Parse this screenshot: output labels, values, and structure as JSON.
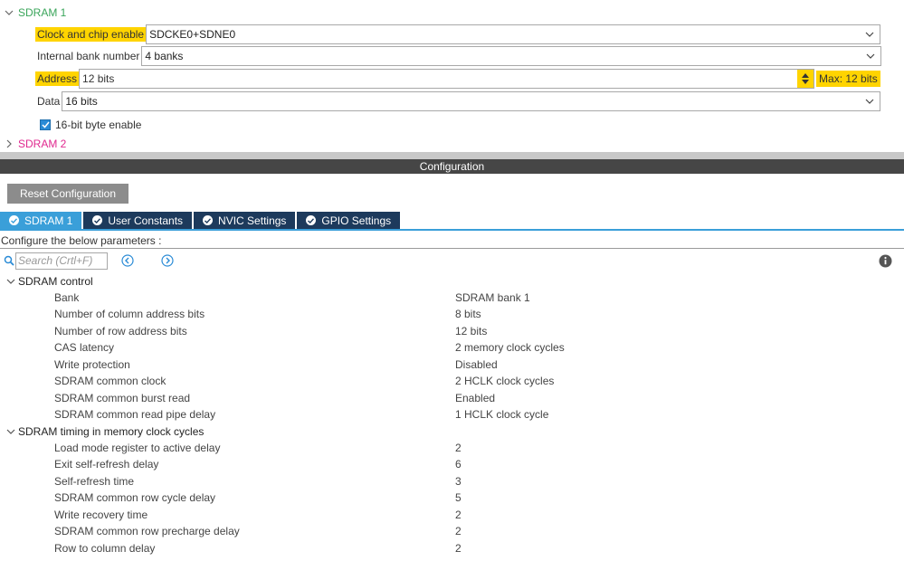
{
  "top_tree": {
    "sdram1": {
      "label": "SDRAM 1"
    },
    "sdram2": {
      "label": "SDRAM 2"
    },
    "clock_chip": {
      "label": "Clock and chip enable",
      "value": "SDCKE0+SDNE0"
    },
    "bank_number": {
      "label": "Internal bank number",
      "value": "4 banks"
    },
    "address": {
      "label": "Address",
      "value": "12 bits",
      "max": "Max: 12 bits"
    },
    "data": {
      "label": "Data",
      "value": "16 bits"
    },
    "byte_enable": {
      "label": "16-bit byte enable",
      "checked": true
    }
  },
  "config_header": "Configuration",
  "reset_button": "Reset Configuration",
  "tabs": [
    {
      "label": "SDRAM 1",
      "active": true
    },
    {
      "label": "User Constants",
      "active": false
    },
    {
      "label": "NVIC Settings",
      "active": false
    },
    {
      "label": "GPIO Settings",
      "active": false
    }
  ],
  "configure_text": "Configure the below parameters :",
  "search": {
    "placeholder": "Search (Crtl+F)"
  },
  "sections": [
    {
      "title": "SDRAM control",
      "params": [
        {
          "name": "Bank",
          "value": "SDRAM bank 1"
        },
        {
          "name": "Number of column address bits",
          "value": "8 bits"
        },
        {
          "name": "Number of row address bits",
          "value": "12 bits"
        },
        {
          "name": "CAS latency",
          "value": "2 memory clock cycles"
        },
        {
          "name": "Write protection",
          "value": "Disabled"
        },
        {
          "name": "SDRAM common clock",
          "value": "2 HCLK clock cycles"
        },
        {
          "name": "SDRAM common burst read",
          "value": "Enabled"
        },
        {
          "name": "SDRAM common read pipe delay",
          "value": "1 HCLK clock cycle"
        }
      ]
    },
    {
      "title": "SDRAM timing in memory clock cycles",
      "params": [
        {
          "name": "Load mode register to active delay",
          "value": "2"
        },
        {
          "name": "Exit self-refresh delay",
          "value": "6"
        },
        {
          "name": "Self-refresh time",
          "value": "3"
        },
        {
          "name": "SDRAM common row cycle delay",
          "value": "5"
        },
        {
          "name": "Write recovery time",
          "value": "2"
        },
        {
          "name": "SDRAM common row precharge delay",
          "value": "2"
        },
        {
          "name": "Row to column delay",
          "value": "2"
        }
      ]
    }
  ],
  "icons": {
    "expanded": "chevron-down-icon",
    "collapsed": "chevron-right-icon",
    "search": "search-icon",
    "prev": "arrow-left-circle-icon",
    "next": "arrow-right-circle-icon",
    "info": "info-icon",
    "tab_status": "check-circle-icon"
  },
  "colors": {
    "highlight": "#ffd400",
    "tab_active": "#3a9fd9",
    "tab_inactive": "#1d3a5c",
    "sdram1_label": "#3aa55a",
    "sdram2_label": "#e0288f",
    "config_bar": "#464646"
  }
}
